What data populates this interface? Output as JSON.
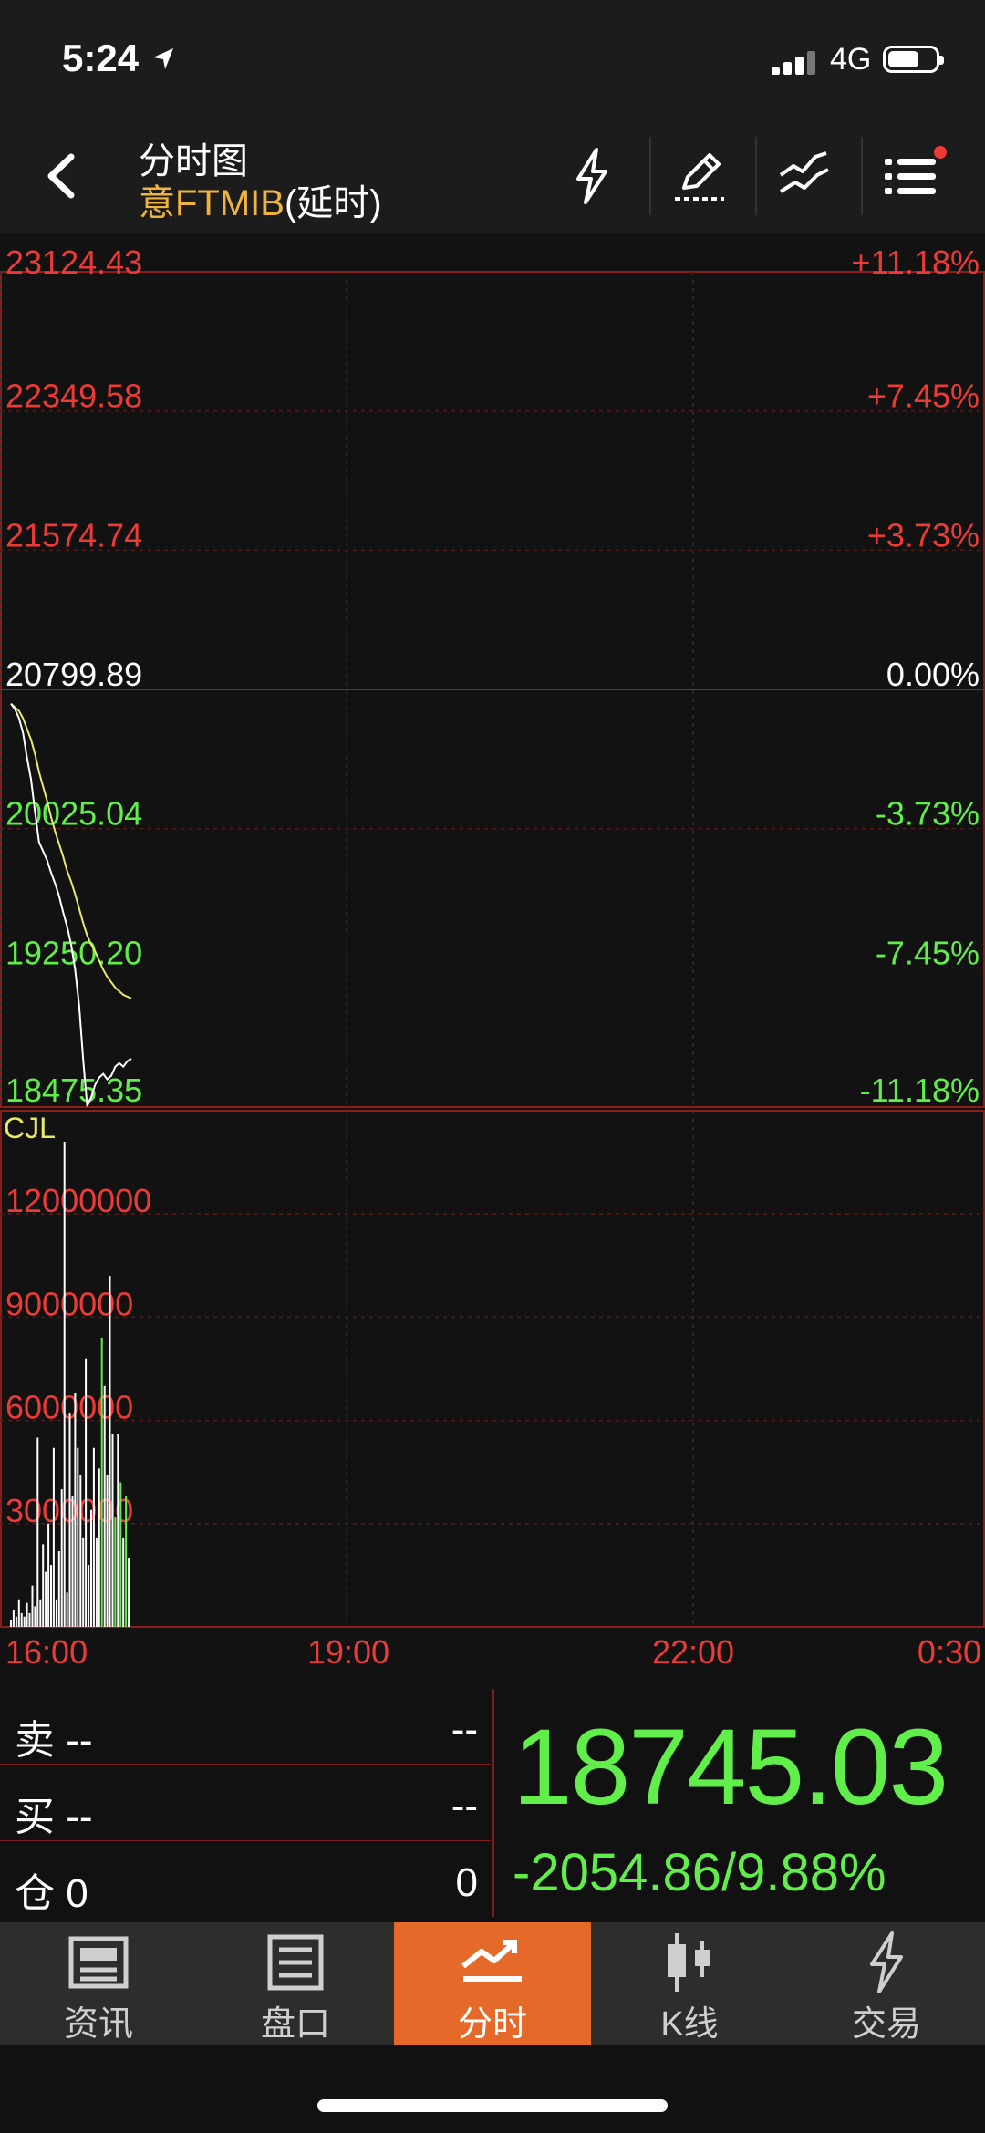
{
  "status_bar": {
    "time": "5:24",
    "network": "4G",
    "battery_level": 0.65
  },
  "header": {
    "title": "分时图",
    "instrument_name": "意FTMIB",
    "delay_label": "(延时)"
  },
  "chart_data": [
    {
      "type": "line",
      "title": "",
      "y_labels_left": [
        "23124.43",
        "22349.58",
        "21574.74",
        "20799.89",
        "20025.04",
        "19250.20",
        "18475.35"
      ],
      "y_labels_right": [
        "+11.18%",
        "+7.45%",
        "+3.73%",
        "0.00%",
        "-3.73%",
        "-7.45%",
        "-11.18%"
      ],
      "ylim": [
        18475.35,
        23124.43
      ],
      "reference_price": 20799.89,
      "x_ticks": [
        "16:00",
        "19:00",
        "22:00",
        "0:30"
      ],
      "series": [
        {
          "color": "#ffffff",
          "values": [
            20720,
            20690,
            20640,
            20560,
            20420,
            20300,
            20120,
            19950,
            19900,
            19850,
            19780,
            19720,
            19650,
            19560,
            19480,
            19380,
            19240,
            19040,
            18740,
            18480,
            18530,
            18600,
            18640,
            18660,
            18630,
            18650,
            18700,
            18720,
            18700,
            18730,
            18745
          ]
        },
        {
          "color": "#e8ea6a",
          "values": [
            20720,
            20700,
            20680,
            20640,
            20580,
            20520,
            20440,
            20340,
            20260,
            20180,
            20090,
            20010,
            19940,
            19870,
            19790,
            19730,
            19660,
            19580,
            19500,
            19430,
            19380,
            19340,
            19290,
            19240,
            19200,
            19170,
            19140,
            19120,
            19100,
            19090,
            19080
          ]
        }
      ]
    },
    {
      "type": "bar",
      "title": "CJL",
      "y_labels": [
        "12000000",
        "9000000",
        "6000000",
        "3000000"
      ],
      "ylim": [
        0,
        15000000
      ],
      "values": [
        200000,
        500000,
        300000,
        800000,
        400000,
        300000,
        700000,
        400000,
        1200000,
        600000,
        5500000,
        800000,
        2400000,
        1600000,
        3000000,
        1800000,
        5200000,
        800000,
        2200000,
        4000000,
        14100000,
        1000000,
        6200000,
        3800000,
        6800000,
        5200000,
        4400000,
        2600000,
        7800000,
        1800000,
        3400000,
        5200000,
        2600000,
        4600000,
        8400000,
        7000000,
        4400000,
        10200000,
        5600000,
        3200000,
        5600000,
        4200000,
        2600000,
        3800000,
        2000000
      ],
      "green_indices": [
        34,
        39,
        41,
        43
      ]
    }
  ],
  "quote_panel": {
    "sell_label": "卖 --",
    "sell_value": "--",
    "buy_label": "买 --",
    "buy_value": "--",
    "position_label": "仓 0",
    "position_value": "0",
    "last_price": "18745.03",
    "change": "-2054.86/9.88%"
  },
  "tabs": [
    {
      "label": "资讯",
      "icon": "newspaper-icon"
    },
    {
      "label": "盘口",
      "icon": "order-book-icon"
    },
    {
      "label": "分时",
      "icon": "intraday-chart-icon"
    },
    {
      "label": "K线",
      "icon": "candlestick-icon"
    },
    {
      "label": "交易",
      "icon": "lightning-trade-icon"
    }
  ],
  "colors": {
    "up": "#ec3a36",
    "down": "#62ee4a",
    "accent": "#e56a2a",
    "avg_line": "#e8ea6a",
    "gold": "#f0b43c"
  }
}
